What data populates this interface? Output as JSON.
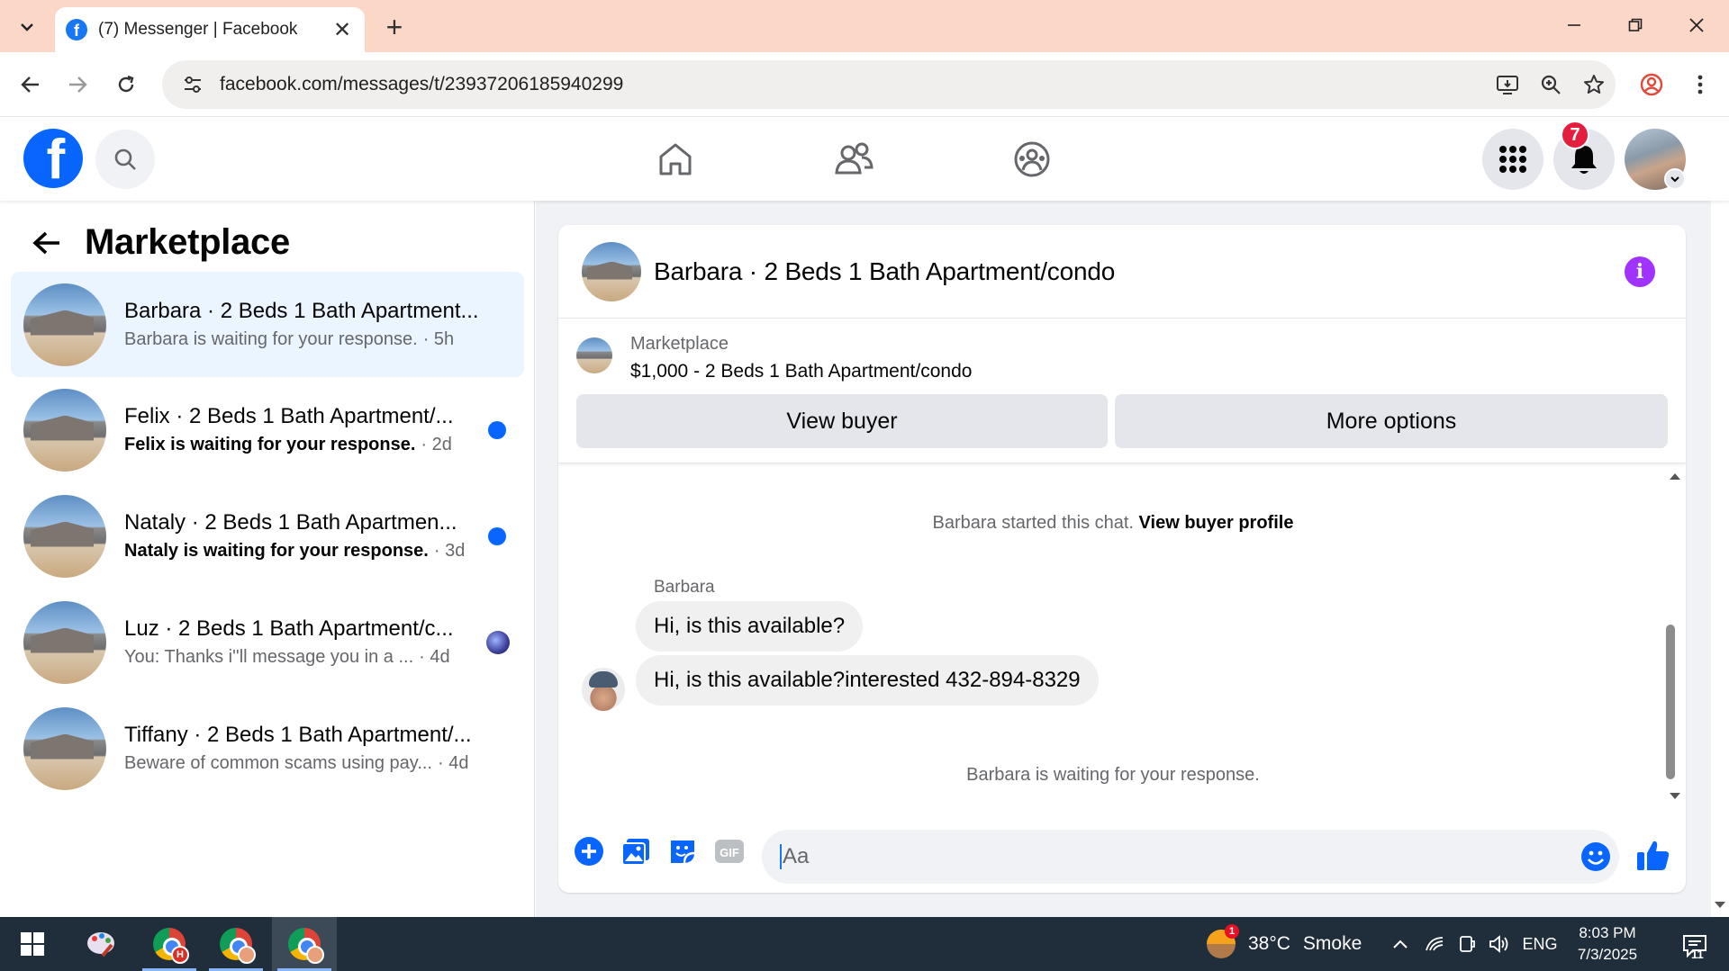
{
  "browser": {
    "tab_title": "(7) Messenger | Facebook",
    "url": "facebook.com/messages/t/23937206185940299"
  },
  "fb_header": {
    "logo": "f",
    "notification_count": "7"
  },
  "marketplace": {
    "title": "Marketplace",
    "conversations": [
      {
        "name": "Barbara · 2 Beds 1 Bath Apartment...",
        "preview": "Barbara is waiting for your response.",
        "time": "· 5h",
        "unread": false,
        "active": true
      },
      {
        "name": "Felix · 2 Beds 1 Bath Apartment/...",
        "preview": "Felix is waiting for your response.",
        "time": "· 2d",
        "unread": true,
        "active": false
      },
      {
        "name": "Nataly · 2 Beds 1 Bath Apartmen...",
        "preview": "Nataly is waiting for your response.",
        "time": "· 3d",
        "unread": true,
        "active": false
      },
      {
        "name": "Luz · 2 Beds 1 Bath Apartment/c...",
        "preview": "You: Thanks i''ll message you in a ...",
        "time": "· 4d",
        "unread": false,
        "active": false
      },
      {
        "name": "Tiffany · 2 Beds 1 Bath Apartment/...",
        "preview": "Beware of common scams using pay...",
        "time": "· 4d",
        "unread": false,
        "active": false
      }
    ]
  },
  "chat": {
    "title": "Barbara · 2 Beds 1 Bath Apartment/condo",
    "info_glyph": "i",
    "listing": {
      "label": "Marketplace",
      "price_title": "$1,000 - 2 Beds 1 Bath Apartment/condo",
      "view_buyer_label": "View buyer",
      "more_options_label": "More options"
    },
    "started_text": "Barbara started this chat.",
    "view_profile_link": "View buyer profile",
    "sender": "Barbara",
    "messages": [
      "Hi, is this available?",
      "Hi, is this available?interested 432-894-8329"
    ],
    "waiting_text": "Barbara is waiting for your response.",
    "composer": {
      "placeholder": "Aa"
    }
  },
  "taskbar": {
    "weather_temp": "38°C",
    "weather_desc": "Smoke",
    "weather_badge": "1",
    "language": "ENG",
    "time": "8:03 PM",
    "date": "7/3/2025",
    "notification_count": "11",
    "chrome_badge": "H"
  },
  "colors": {
    "fb_blue": "#0866ff",
    "tab_strip": "#fbd7c8",
    "taskbar": "#202d3a",
    "active_conversation": "#ebf5ff",
    "badge_red": "#e41e3f",
    "info_purple": "#a033ff"
  }
}
